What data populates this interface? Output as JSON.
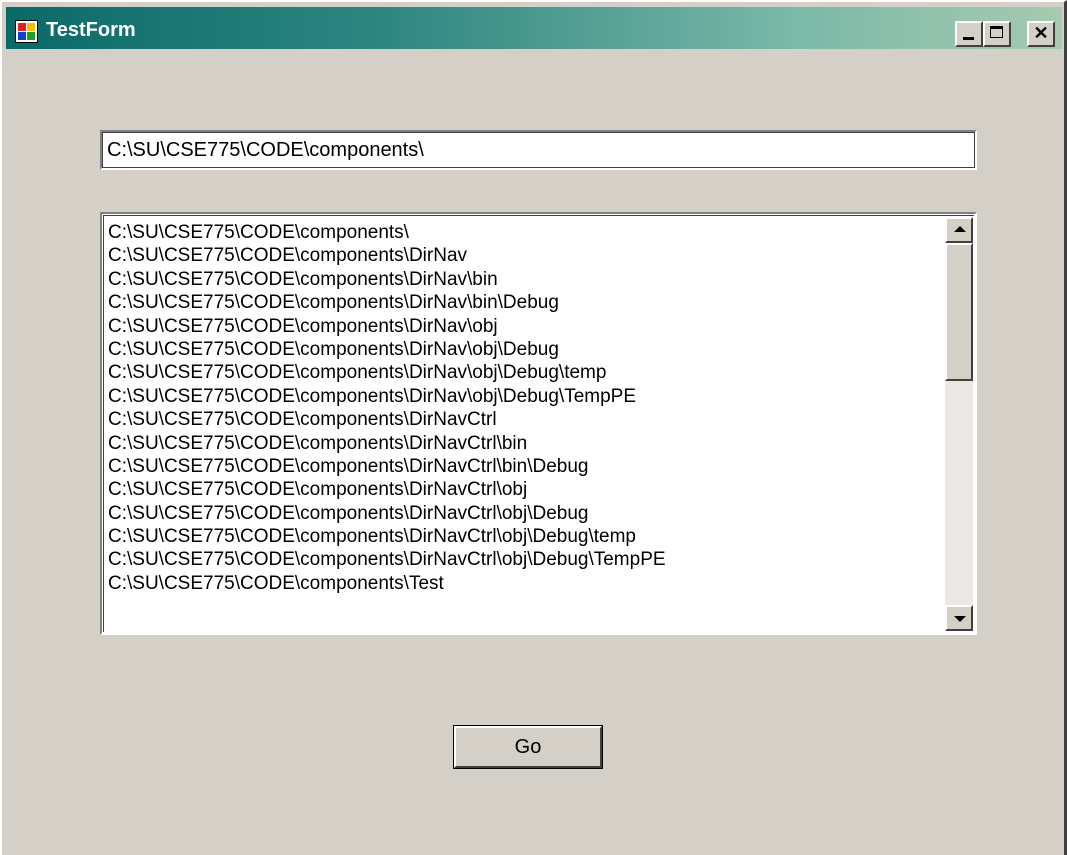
{
  "window": {
    "title": "TestForm",
    "icon": "app-form-icon",
    "controls": {
      "minimize": "minimize-icon",
      "maximize": "maximize-icon",
      "close_glyph": "✕"
    }
  },
  "path_input": {
    "value": "C:\\SU\\CSE775\\CODE\\components\\"
  },
  "directory_list": {
    "items": [
      "C:\\SU\\CSE775\\CODE\\components\\",
      "C:\\SU\\CSE775\\CODE\\components\\DirNav",
      "C:\\SU\\CSE775\\CODE\\components\\DirNav\\bin",
      "C:\\SU\\CSE775\\CODE\\components\\DirNav\\bin\\Debug",
      "C:\\SU\\CSE775\\CODE\\components\\DirNav\\obj",
      "C:\\SU\\CSE775\\CODE\\components\\DirNav\\obj\\Debug",
      "C:\\SU\\CSE775\\CODE\\components\\DirNav\\obj\\Debug\\temp",
      "C:\\SU\\CSE775\\CODE\\components\\DirNav\\obj\\Debug\\TempPE",
      "C:\\SU\\CSE775\\CODE\\components\\DirNavCtrl",
      "C:\\SU\\CSE775\\CODE\\components\\DirNavCtrl\\bin",
      "C:\\SU\\CSE775\\CODE\\components\\DirNavCtrl\\bin\\Debug",
      "C:\\SU\\CSE775\\CODE\\components\\DirNavCtrl\\obj",
      "C:\\SU\\CSE775\\CODE\\components\\DirNavCtrl\\obj\\Debug",
      "C:\\SU\\CSE775\\CODE\\components\\DirNavCtrl\\obj\\Debug\\temp",
      "C:\\SU\\CSE775\\CODE\\components\\DirNavCtrl\\obj\\Debug\\TempPE",
      "C:\\SU\\CSE775\\CODE\\components\\Test"
    ]
  },
  "go_button": {
    "label": "Go"
  },
  "colors": {
    "titlebar_start": "#0a6a68",
    "titlebar_end": "#a6cab0",
    "face": "#d4d0c8",
    "desktop": "#ffffc0"
  }
}
